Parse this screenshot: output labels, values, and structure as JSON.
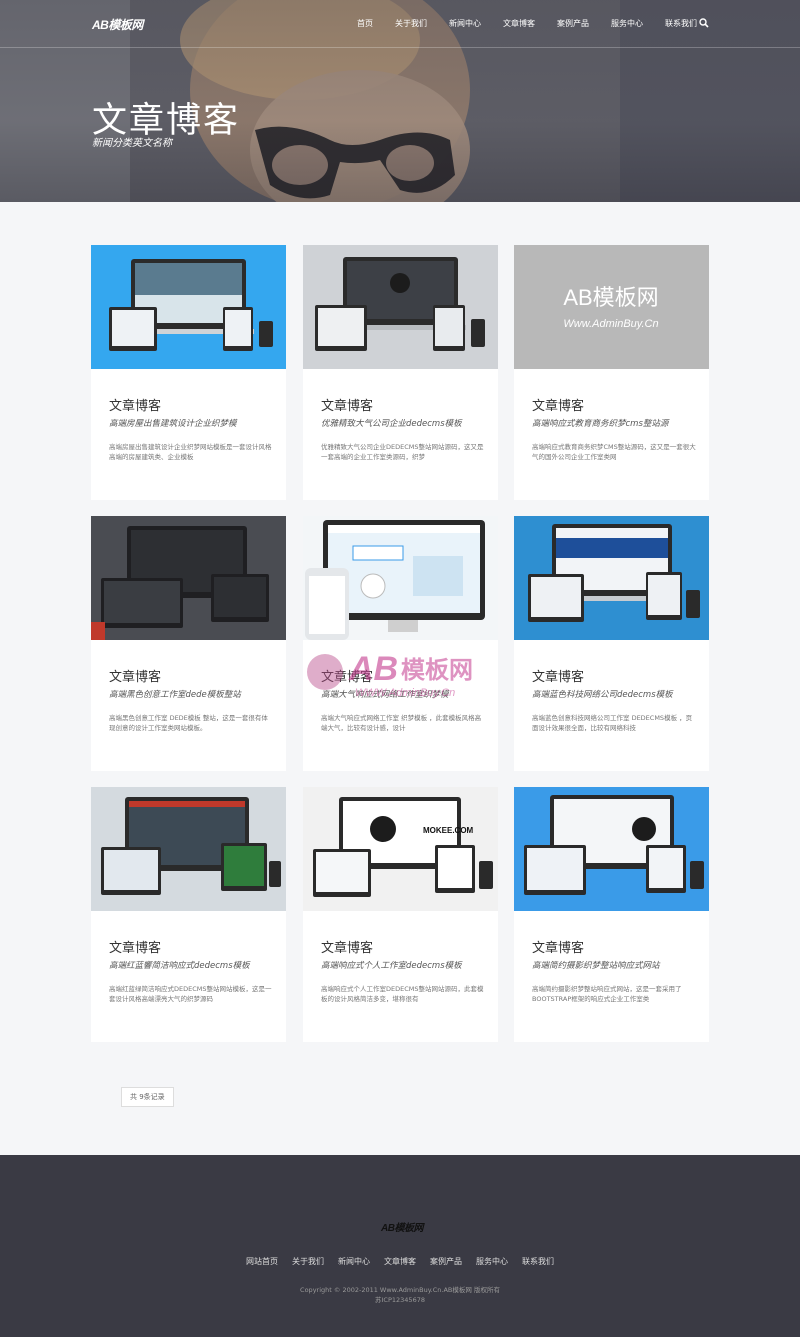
{
  "header": {
    "logo": "AB模板网",
    "nav": [
      "首页",
      "关于我们",
      "新闻中心",
      "文章博客",
      "案例产品",
      "服务中心",
      "联系我们"
    ]
  },
  "hero": {
    "title": "文章博客",
    "subtitle": "新闻分类英文名称"
  },
  "cards": [
    {
      "title": "文章博客",
      "subtitle": "高端房屋出售建筑设计企业织梦模",
      "desc": "高端房屋出售建筑设计企业织梦网站模板是一套设计风格高端的房屋建筑类、企业模板"
    },
    {
      "title": "文章博客",
      "subtitle": "优雅精致大气公司企业dedecms模板",
      "desc": "优雅精致大气公司企业DEDECMS整站网站源码，这又是一套高端的企业工作室类源码，织梦"
    },
    {
      "title": "文章博客",
      "subtitle": "高端响应式教育商务织梦cms整站源",
      "desc": "高端响应式教育商务织梦CMS整站源码，这又是一套很大气的国外公司企业工作室类网"
    },
    {
      "title": "文章博客",
      "subtitle": "高端黑色创意工作室dede模板整站",
      "desc": "高端黑色创意工作室 DEDE模板 整站，这是一套很有体现创意的设计工作室类网站模板。"
    },
    {
      "title": "文章博客",
      "subtitle": "高端大气响应式网络工作室织梦模",
      "desc": "高端大气响应式网络工作室 织梦模板 ，此套模板风格高端大气，比较有设计感，设计"
    },
    {
      "title": "文章博客",
      "subtitle": "高端蓝色科技网络公司dedecms模板",
      "desc": "高端蓝色创意科技网络公司工作室 DEDECMS模板 ，页面设计效果很全面，比较有网络科技"
    },
    {
      "title": "文章博客",
      "subtitle": "高端红蓝響简洁响应式dedecms模板",
      "desc": "高端红蓝绿简洁响应式DEDECMS整站网站模板，这是一套设计风格高端漂亮大气的织梦源码"
    },
    {
      "title": "文章博客",
      "subtitle": "高端响应式个人工作室dedecms模板",
      "desc": "高端响应式个人工作室DEDECMS整站网站源码，此套模板的设计风格简洁多变，堪称很有"
    },
    {
      "title": "文章博客",
      "subtitle": "高端简约摄影织梦整站响应式网站",
      "desc": "高端简约摄影织梦整站响应式网站，这是一套采用了BOOTSTRAP框架的响应式企业工作室类"
    }
  ],
  "watermark": {
    "brand": "AB模板网",
    "url": "WWW.AdminBuy.Cn"
  },
  "pagination": {
    "label": "共 9条记录"
  },
  "footer": {
    "logo": "AB模板网",
    "nav": [
      "网站首页",
      "关于我们",
      "新闻中心",
      "文章博客",
      "案例产品",
      "服务中心",
      "联系我们"
    ],
    "copyright": "Copyright © 2002-2011 Www.AdminBuy.Cn.AB模板网 版权所有",
    "icp": "苏ICP12345678"
  },
  "colors": {
    "footer_bg": "#3a3a44",
    "page_bg": "#f5f6f8",
    "card_bg": "#ffffff",
    "accent_blue": "#3a9be8"
  }
}
